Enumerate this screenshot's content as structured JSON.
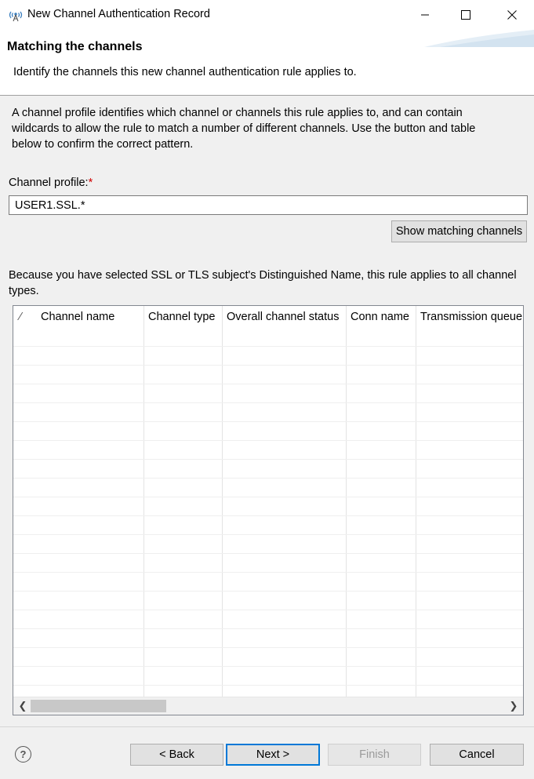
{
  "window": {
    "title": "New Channel Authentication Record",
    "app_icon": "mq-channel-icon",
    "controls": [
      "minimize-icon",
      "maximize-icon",
      "close-icon"
    ]
  },
  "header": {
    "title": "Matching the channels",
    "subtitle": "Identify the channels this new channel authentication rule applies to."
  },
  "intro": {
    "line1": "A channel profile identifies which channel or channels this rule applies to, and can contain",
    "line2": "wildcards to allow the rule to match a number of different channels. Use the button and table",
    "line3": "below to confirm the correct pattern."
  },
  "profile": {
    "label": "Channel profile:",
    "required_marker": "*",
    "value": "USER1.SSL.*"
  },
  "show_button_label": "Show matching channels",
  "note": {
    "line1": "Because you have selected SSL or TLS subject's Distinguished Name, this rule applies to all channel",
    "line2": "types."
  },
  "table": {
    "sort_indicator": "∕",
    "columns": [
      "Channel name",
      "Channel type",
      "Overall channel status",
      "Conn name",
      "Transmission queue"
    ],
    "rows": []
  },
  "footer": {
    "help": "?",
    "back": "< Back",
    "next": "Next >",
    "finish": "Finish",
    "cancel": "Cancel"
  },
  "colors": {
    "accent_border": "#0078d7",
    "required": "#d00000",
    "disabled_text": "#9a9a9a"
  }
}
